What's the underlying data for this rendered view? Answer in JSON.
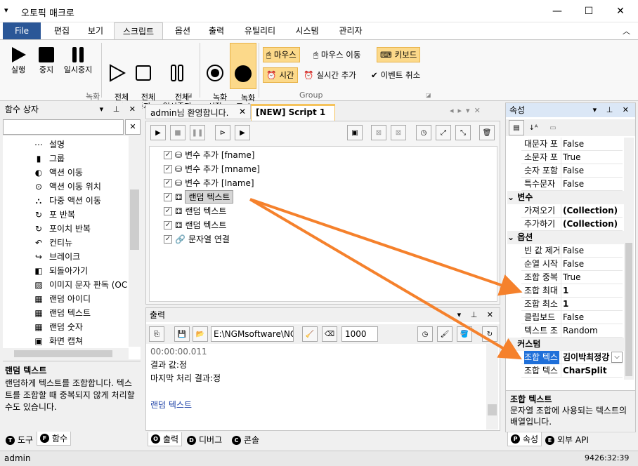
{
  "window": {
    "title": "오토픽 매크로",
    "min": "—",
    "max": "☐",
    "close": "✕"
  },
  "menu": {
    "file": "File",
    "tabs": [
      "편집",
      "보기",
      "스크립트",
      "옵션",
      "출력",
      "유틸리티",
      "시스템",
      "관리자"
    ]
  },
  "ribbon": {
    "run": "실행",
    "stop": "중지",
    "pause": "일시중지",
    "all_run": "전체\n실행",
    "all_stop": "전체\n중지",
    "all_pause": "전체\n일시중지",
    "rec_start": "녹화\n시작",
    "rec_stop": "녹화\n중지",
    "mouse": "마우스",
    "mouse_move": "마우스 이동",
    "keyboard": "키보드",
    "time": "시간",
    "realtime_add": "실시간 추가",
    "event_cancel": "이벤트 취소",
    "group_record": "녹화",
    "group_group": "Group"
  },
  "function_box": {
    "title": "함수 상자",
    "items": [
      "설명",
      "그룹",
      "액션 이동",
      "액션 이동 위치",
      "다중 액션 이동",
      "포 반복",
      "포이치 반복",
      "컨티뉴",
      "브레이크",
      "되돌아가기",
      "이미지 문자 판독 (OC",
      "랜덤 아이디",
      "랜덤 텍스트",
      "랜덤 숫자",
      "화면 캡쳐"
    ],
    "desc_title": "랜덤 텍스트",
    "desc": "랜덤하게 텍스트를 조합합니다. 텍스트를 조합할 때 중복되지 않게 처리할수도 있습니다."
  },
  "left_tabs": {
    "tool": "도구",
    "func": "함수"
  },
  "doc_tabs": [
    "admin님 환영합니다.",
    "[NEW] Script 1"
  ],
  "script_lines": [
    "변수 추가 [fname]",
    "변수 추가 [mname]",
    "변수 추가 [lname]",
    "랜덤 텍스트",
    "랜덤 텍스트",
    "랜덤 텍스트",
    "문자열 연결"
  ],
  "output": {
    "title": "출력",
    "path": "E:\\NGMsoftware\\NG",
    "count": "1000",
    "lines": [
      "00:00:00.011",
      "결과 값:정",
      "마지막 처리 결과:정",
      "",
      "랜덤 텍스트"
    ]
  },
  "bottom_tabs": {
    "output": "출력",
    "debug": "디버그",
    "console": "콘솔"
  },
  "properties": {
    "title": "속성",
    "rows1": [
      [
        "대문자 포",
        "False"
      ],
      [
        "소문자 포",
        "True"
      ],
      [
        "숫자 포함",
        "False"
      ],
      [
        "특수문자",
        "False"
      ]
    ],
    "cat_var": "변수",
    "rows2": [
      [
        "가져오기",
        "(Collection)"
      ],
      [
        "추가하기",
        "(Collection)"
      ]
    ],
    "cat_opt": "옵션",
    "rows3": [
      [
        "빈 값 제거",
        "False"
      ],
      [
        "순열 시작",
        "False"
      ],
      [
        "조합 중복",
        "True"
      ],
      [
        "조합 최대",
        "1"
      ],
      [
        "조합 최소",
        "1"
      ],
      [
        "클립보드",
        "False"
      ],
      [
        "텍스트 조",
        "Random"
      ]
    ],
    "cat_custom": "커스텀",
    "rows4": [
      [
        "조합 텍스",
        "김이박최정강"
      ],
      [
        "조합 텍스",
        "CharSplit"
      ]
    ],
    "desc_title": "조합 텍스트",
    "desc": "문자열 조합에 사용되는 텍스트의 배열입니다."
  },
  "right_tabs": {
    "prop": "속성",
    "api": "외부 API"
  },
  "status": {
    "user": "admin",
    "clock": "9426:32:39"
  },
  "colors": {
    "accent": "#2b5797",
    "highlight": "#fcd98a",
    "arrow": "#f5812c"
  }
}
